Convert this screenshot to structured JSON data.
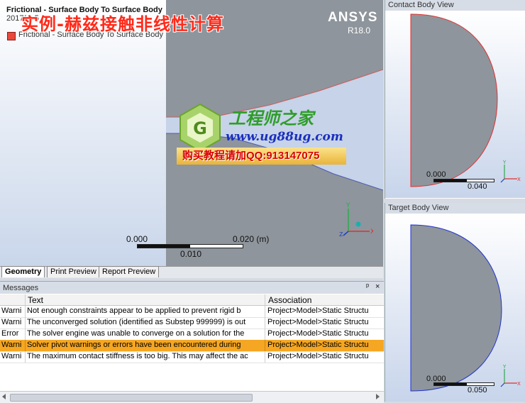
{
  "graphics": {
    "header": {
      "title": "Frictional - Surface Body To Surface Body",
      "subtitle": "2017/... 5",
      "legend_item": "Frictional - Surface Body To Surface Body"
    },
    "overlay_title": "实例-赫兹接触非线性计算",
    "ansys_logo": "ANSYS",
    "version": "R18.0",
    "scale": {
      "left": "0.000",
      "right": "0.020 (m)",
      "mid": "0.010"
    },
    "watermark": {
      "brand": "工程师之家",
      "url": "www.ug88ug.com",
      "contact": "购买教程请加QQ:913147075"
    }
  },
  "tabs": [
    "Geometry",
    "Print Preview",
    "Report Preview"
  ],
  "messages": {
    "title": "Messages",
    "pin": "ᵖ",
    "close": "×",
    "columns": [
      "Text",
      "Association"
    ],
    "rows": [
      {
        "type": "Warni",
        "text": "Not enough constraints appear to be applied to prevent rigid b",
        "assoc": "Project>Model>Static Structu"
      },
      {
        "type": "Warni",
        "text": "The unconverged solution (identified as Substep 999999) is out",
        "assoc": "Project>Model>Static Structu"
      },
      {
        "type": "Error",
        "text": "The solver engine was unable to converge on a solution for the",
        "assoc": "Project>Model>Static Structu"
      },
      {
        "type": "Warni",
        "text": "Solver pivot warnings or errors have been encountered during",
        "assoc": "Project>Model>Static Structu"
      },
      {
        "type": "Warni",
        "text": "The maximum contact stiffness is too big. This may affect the ac",
        "assoc": "Project>Model>Static Structu"
      }
    ]
  },
  "contact_view": {
    "title": "Contact Body View",
    "scale_left": "0.000",
    "scale_right": "0.040"
  },
  "target_view": {
    "title": "Target Body View",
    "scale_left": "0.000",
    "scale_right": "0.050"
  },
  "colors": {
    "accent_orange": "#f5a623",
    "contact_edge": "#e03030",
    "target_edge": "#2233cc"
  }
}
